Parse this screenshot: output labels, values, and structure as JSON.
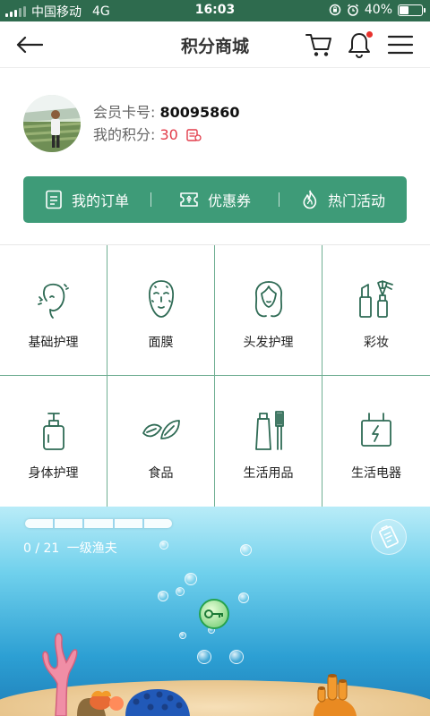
{
  "status_bar": {
    "carrier": "中国移动",
    "network": "4G",
    "time": "16:03",
    "battery_text": "40%",
    "battery_level": 0.4
  },
  "nav": {
    "title": "积分商城",
    "icons": [
      "back-arrow-icon",
      "cart-icon",
      "bell-icon",
      "menu-icon"
    ],
    "notification_dot_color": "#e8322d"
  },
  "profile": {
    "card_label": "会员卡号:",
    "card_number": "80095860",
    "points_label": "我的积分:",
    "points_value": "30"
  },
  "quick_actions": [
    {
      "label": "我的订单",
      "icon": "document-icon"
    },
    {
      "label": "优惠券",
      "icon": "coupon-icon"
    },
    {
      "label": "热门活动",
      "icon": "flame-icon"
    }
  ],
  "categories": [
    {
      "label": "基础护理",
      "icon": "face-care-icon"
    },
    {
      "label": "面膜",
      "icon": "face-mask-icon"
    },
    {
      "label": "头发护理",
      "icon": "hair-care-icon"
    },
    {
      "label": "彩妆",
      "icon": "makeup-icon"
    },
    {
      "label": "身体护理",
      "icon": "pump-bottle-icon"
    },
    {
      "label": "食品",
      "icon": "leaf-icon"
    },
    {
      "label": "生活用品",
      "icon": "toothbrush-icon"
    },
    {
      "label": "生活电器",
      "icon": "appliance-icon"
    }
  ],
  "game": {
    "progress_text": "0 / 21",
    "level_name": "一级渔夫",
    "progress_fraction": 0
  },
  "colors": {
    "brand_green": "#3e9b78",
    "status_bar": "#2e6b4e",
    "grid_line": "#6fae92",
    "points_red": "#e23c4a"
  }
}
